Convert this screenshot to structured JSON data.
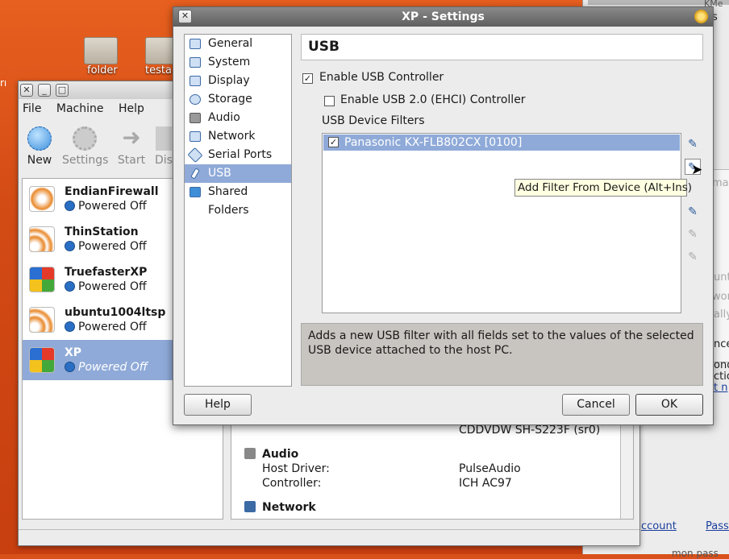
{
  "desktop": {
    "folders": [
      {
        "label": "folder"
      },
      {
        "label": "testa"
      }
    ],
    "left_fragment": "rı"
  },
  "right_window": {
    "title_fragment": "KMe",
    "s_fragment": "s",
    "texts": [
      "mail",
      "unt",
      "word",
      "ally",
      "nce",
      "ond",
      "ction",
      "t n"
    ],
    "links": [
      "ccount",
      "Passw"
    ],
    "bottom": "mon pass"
  },
  "vbox": {
    "menu": [
      "File",
      "Machine",
      "Help"
    ],
    "toolbar": [
      {
        "label": "New",
        "icon": "new-icon"
      },
      {
        "label": "Settings",
        "icon": "settings-icon"
      },
      {
        "label": "Start",
        "icon": "start-icon"
      },
      {
        "label": "Dis",
        "icon": "discard-icon"
      }
    ],
    "vms": [
      {
        "name": "EndianFirewall",
        "status": "Powered Off"
      },
      {
        "name": "ThinStation",
        "status": "Powered Off"
      },
      {
        "name": "TruefasterXP",
        "status": "Powered Off"
      },
      {
        "name": "ubuntu1004ltsp",
        "status": "Powered Off"
      },
      {
        "name": "XP",
        "status": "Powered Off"
      }
    ],
    "details": {
      "optical": "CDDVDW SH-S223F (sr0)",
      "audio_heading": "Audio",
      "host_driver_label": "Host Driver:",
      "host_driver_value": "PulseAudio",
      "controller_label": "Controller:",
      "controller_value": "ICH AC97",
      "network_heading": "Network"
    }
  },
  "settings": {
    "title": "XP - Settings",
    "nav": [
      "General",
      "System",
      "Display",
      "Storage",
      "Audio",
      "Network",
      "Serial Ports",
      "USB",
      "Shared Folders"
    ],
    "selected_nav": "USB",
    "page_title": "USB",
    "enable_usb": {
      "label": "Enable USB Controller",
      "checked": true
    },
    "enable_usb2": {
      "label": "Enable USB 2.0 (EHCI) Controller",
      "checked": false
    },
    "filters_label": "USB Device Filters",
    "filters": [
      {
        "label": "Panasonic KX-FLB802CX [0100]",
        "checked": true
      }
    ],
    "tooltip": "Add Filter From Device (Alt+Ins)",
    "description": "Adds a new USB filter with all fields set to the values of the selected USB device attached to the host PC.",
    "help": "Help",
    "cancel": "Cancel",
    "ok": "OK"
  },
  "colors": {
    "selection": "#8faad8",
    "desktop": "#d9511a",
    "tooltip": "#ffffe1"
  }
}
